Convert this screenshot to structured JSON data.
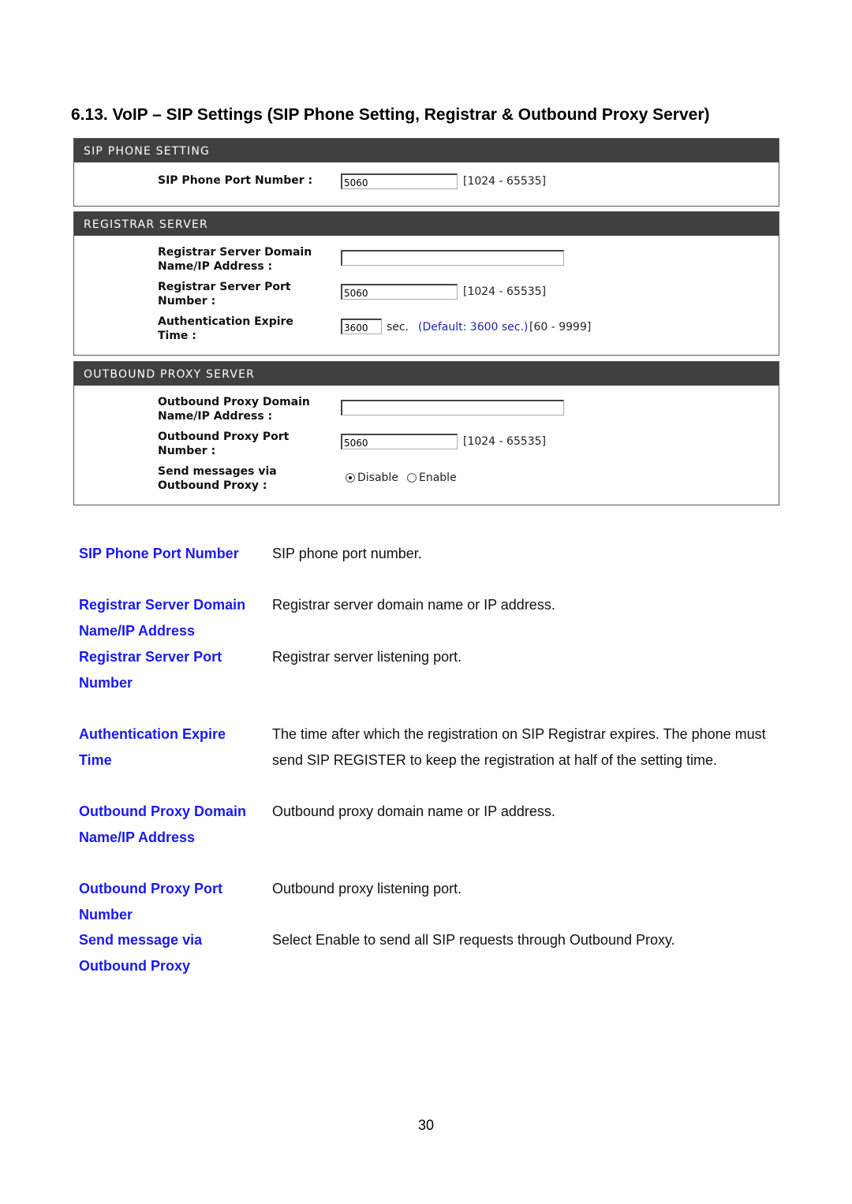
{
  "heading": "6.13. VoIP – SIP Settings (SIP Phone Setting, Registrar & Outbound Proxy Server)",
  "sip_phone_setting": {
    "title": "SIP PHONE SETTING",
    "port_label": "SIP Phone Port Number :",
    "port_value": "5060",
    "port_range": "[1024 - 65535]"
  },
  "registrar_server": {
    "title": "REGISTRAR SERVER",
    "domain_label_1": "Registrar Server Domain",
    "domain_label_2": "Name/IP Address :",
    "domain_value": "",
    "port_label_1": "Registrar Server Port",
    "port_label_2": "Number :",
    "port_value": "5060",
    "port_range": "[1024 - 65535]",
    "expire_label_1": "Authentication Expire",
    "expire_label_2": "Time :",
    "expire_value": "3600",
    "expire_unit": "sec.",
    "expire_default": "(Default: 3600 sec.)",
    "expire_range": "[60 - 9999]"
  },
  "outbound_proxy_server": {
    "title": "OUTBOUND PROXY SERVER",
    "domain_label_1": "Outbound Proxy Domain",
    "domain_label_2": "Name/IP Address :",
    "domain_value": "",
    "port_label_1": "Outbound Proxy Port",
    "port_label_2": "Number :",
    "port_value": "5060",
    "port_range": "[1024 - 65535]",
    "send_label_1": "Send messages via",
    "send_label_2": "Outbound Proxy :",
    "options": [
      "Disable",
      "Enable"
    ],
    "selected": "Disable"
  },
  "descriptions": [
    {
      "term": [
        "SIP Phone Port Number"
      ],
      "definition": [
        "SIP phone port number."
      ]
    },
    {
      "term": [
        "Registrar Server Domain",
        "Name/IP Address"
      ],
      "definition": [
        "Registrar server domain name or IP address."
      ]
    },
    {
      "term": [
        "Registrar Server Port",
        "Number"
      ],
      "definition": [
        "Registrar server listening port."
      ]
    },
    {
      "term": [
        "Authentication Expire",
        "Time"
      ],
      "definition": [
        "The time after which the registration on SIP Registrar expires. The phone must",
        "send SIP REGISTER to keep the registration at half of the setting time."
      ]
    },
    {
      "term": [
        "Outbound Proxy Domain",
        "Name/IP Address"
      ],
      "definition": [
        "Outbound proxy domain name or IP address."
      ]
    },
    {
      "term": [
        "Outbound Proxy Port",
        "Number"
      ],
      "definition": [
        "Outbound proxy listening port."
      ]
    },
    {
      "term": [
        "Send message via",
        "Outbound Proxy"
      ],
      "definition": [
        "Select Enable to send all SIP requests through Outbound Proxy."
      ]
    }
  ],
  "page_number": "30"
}
